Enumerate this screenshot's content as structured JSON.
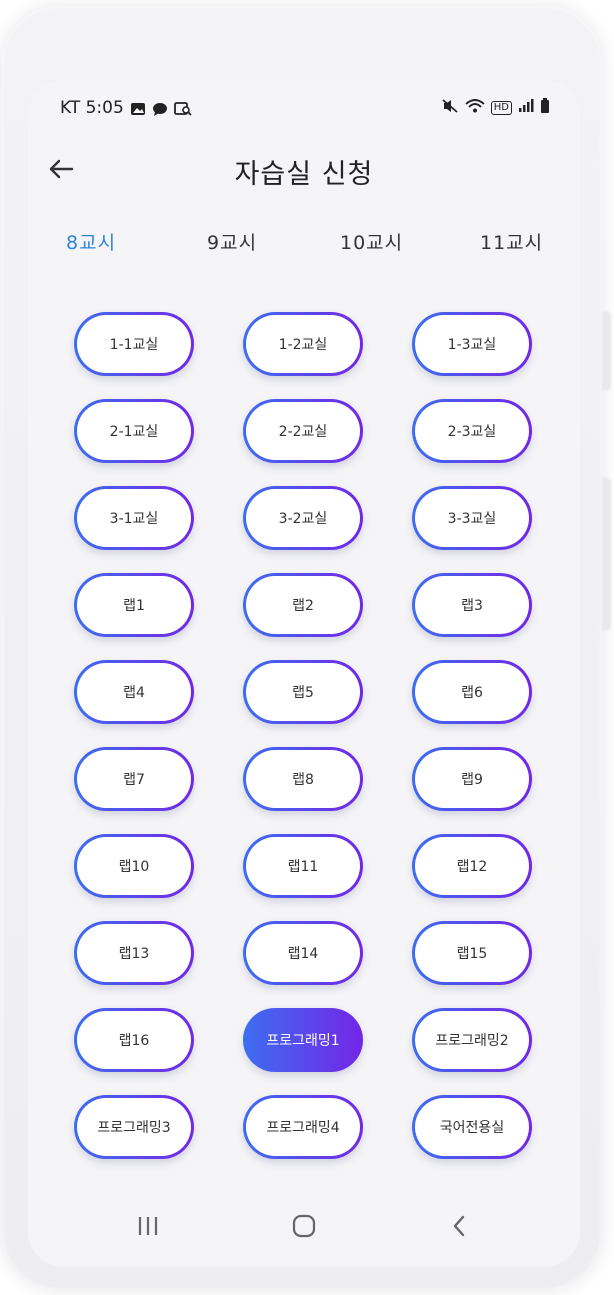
{
  "status_bar": {
    "carrier_time": "KT 5:05",
    "left_icons": [
      "gallery-icon",
      "chat-bubble-icon",
      "screen-search-icon"
    ],
    "right_icons": [
      "mute-icon",
      "wifi-icon",
      "hd-icon",
      "signal-icon",
      "battery-icon"
    ],
    "hd_label": "HD"
  },
  "appbar": {
    "title": "자습실 신청",
    "back_icon": "arrow-left-icon"
  },
  "tabs": [
    {
      "label": "8교시",
      "active": true
    },
    {
      "label": "9교시",
      "active": false
    },
    {
      "label": "10교시",
      "active": false
    },
    {
      "label": "11교시",
      "active": false
    }
  ],
  "rooms": [
    {
      "label": "1-1교실"
    },
    {
      "label": "1-2교실"
    },
    {
      "label": "1-3교실"
    },
    {
      "label": "2-1교실"
    },
    {
      "label": "2-2교실"
    },
    {
      "label": "2-3교실"
    },
    {
      "label": "3-1교실"
    },
    {
      "label": "3-2교실"
    },
    {
      "label": "3-3교실"
    },
    {
      "label": "랩1"
    },
    {
      "label": "랩2"
    },
    {
      "label": "랩3"
    },
    {
      "label": "랩4"
    },
    {
      "label": "랩5"
    },
    {
      "label": "랩6"
    },
    {
      "label": "랩7"
    },
    {
      "label": "랩8"
    },
    {
      "label": "랩9"
    },
    {
      "label": "랩10"
    },
    {
      "label": "랩11"
    },
    {
      "label": "랩12"
    },
    {
      "label": "랩13"
    },
    {
      "label": "랩14"
    },
    {
      "label": "랩15"
    },
    {
      "label": "랩16"
    },
    {
      "label": "프로그래밍1",
      "selected": true
    },
    {
      "label": "프로그래밍2"
    },
    {
      "label": "프로그래밍3"
    },
    {
      "label": "프로그래밍4"
    },
    {
      "label": "국어전용실"
    }
  ],
  "colors": {
    "accent_tab": "#2f86d6",
    "gradient_start": "#3d6ef0",
    "gradient_end": "#7326e6"
  },
  "navbar": {
    "icons": [
      "recent-apps-icon",
      "home-icon",
      "back-icon"
    ]
  }
}
